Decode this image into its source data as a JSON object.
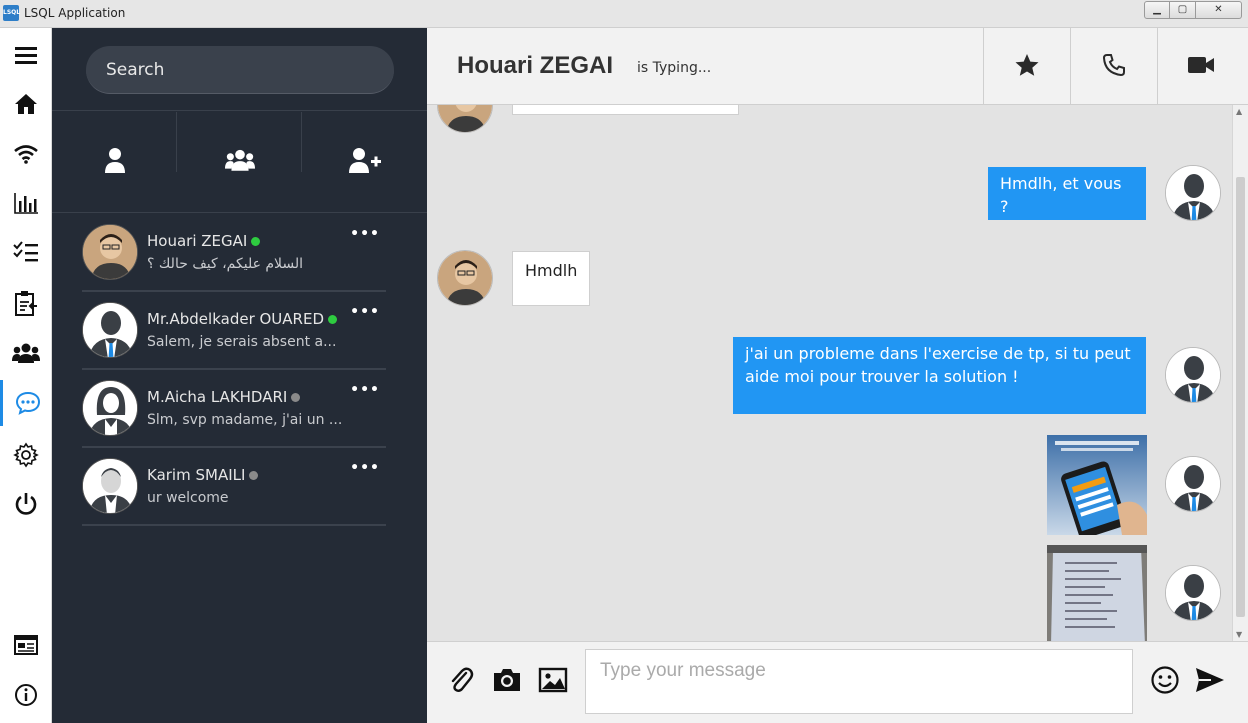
{
  "window": {
    "title": "LSQL Application",
    "icon_text": "LSQL",
    "controls": [
      "minimize-icon",
      "maximize-icon",
      "close-icon"
    ]
  },
  "rail": {
    "items": [
      {
        "icon": "menu-icon"
      },
      {
        "icon": "home-icon"
      },
      {
        "icon": "wifi-icon"
      },
      {
        "icon": "bar-chart-icon"
      },
      {
        "icon": "checklist-icon"
      },
      {
        "icon": "clipboard-icon"
      },
      {
        "icon": "group-icon"
      },
      {
        "icon": "chat-icon",
        "active": true
      },
      {
        "icon": "settings-icon"
      },
      {
        "icon": "power-icon"
      },
      {
        "icon": "card-icon"
      },
      {
        "icon": "info-icon"
      }
    ],
    "accent": "#1e8be5"
  },
  "sidebar": {
    "search_placeholder": "Search",
    "tabs": [
      {
        "icon": "user-icon"
      },
      {
        "icon": "group-icon"
      },
      {
        "icon": "add-user-icon"
      }
    ],
    "contacts": [
      {
        "name": "Houari ZEGAI",
        "online": true,
        "last_message": "السلام عليكم، كيف حالك ؟",
        "more": "•••"
      },
      {
        "name": "Mr.Abdelkader OUARED",
        "online": true,
        "last_message": "Salem, je serais absent a...",
        "more": "•••"
      },
      {
        "name": "M.Aicha LAKHDARI",
        "online": false,
        "last_message": "Slm, svp madame, j'ai un ...",
        "more": "•••"
      },
      {
        "name": "Karim SMAILI",
        "online": false,
        "last_message": "ur welcome",
        "more": "•••"
      }
    ],
    "online_color": "#2ecc40",
    "offline_color": "#8a8a8a"
  },
  "chat": {
    "name": "Houari ZEGAI",
    "status": "is Typing...",
    "header_actions": [
      "star-icon",
      "phone-icon",
      "video-icon"
    ],
    "messages": [
      {
        "direction": "out",
        "text": "Hmdlh, et vous ?"
      },
      {
        "direction": "in",
        "text": "Hmdlh"
      },
      {
        "direction": "out",
        "text": "j'ai un probleme dans l'exercise de tp, si tu peut aide moi pour trouver la solution !"
      },
      {
        "direction": "out",
        "type": "image",
        "alt": "app-promo-image"
      },
      {
        "direction": "out",
        "type": "image",
        "alt": "paper-photo"
      }
    ],
    "outgoing_color": "#2196f3"
  },
  "composer": {
    "placeholder": "Type your message",
    "icons": [
      "attach-icon",
      "camera-icon",
      "image-icon",
      "emoji-icon",
      "send-icon"
    ]
  }
}
